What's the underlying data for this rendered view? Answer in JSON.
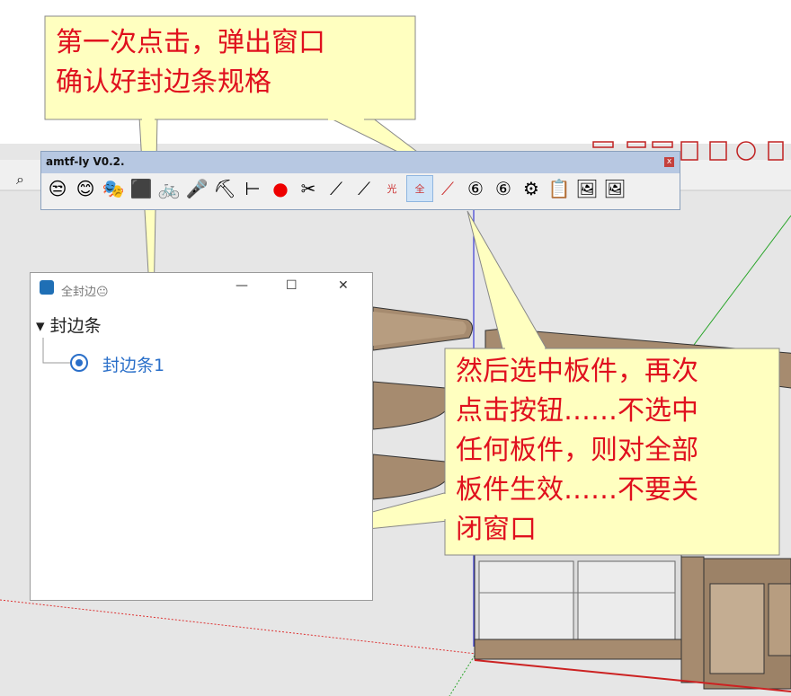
{
  "toolbar": {
    "title": "amtf-ly V0.2.",
    "close": "x",
    "tools": [
      "😒",
      "😊",
      "🎭",
      "⬛",
      "🚲",
      "🎤",
      "⛏",
      "⊢",
      "●",
      "✂",
      "⟋",
      "⟋",
      "光",
      "全",
      "⟋",
      "⑥",
      "⑥",
      "⚙",
      "📋",
      "🖼",
      "🖼"
    ]
  },
  "dialog": {
    "title": "全封边😐",
    "minimize": "—",
    "maximize": "☐",
    "close": "✕",
    "tree_root": "▾ 封边条",
    "tree_child": "封边条1"
  },
  "callouts": {
    "top": [
      "第一次点击，弹出窗口",
      "确认好封边条规格"
    ],
    "right": [
      "然后选中板件，再次",
      "点击按钮……不选中",
      "任何板件，则对全部",
      "板件生效……不要关",
      "闭窗口"
    ]
  }
}
